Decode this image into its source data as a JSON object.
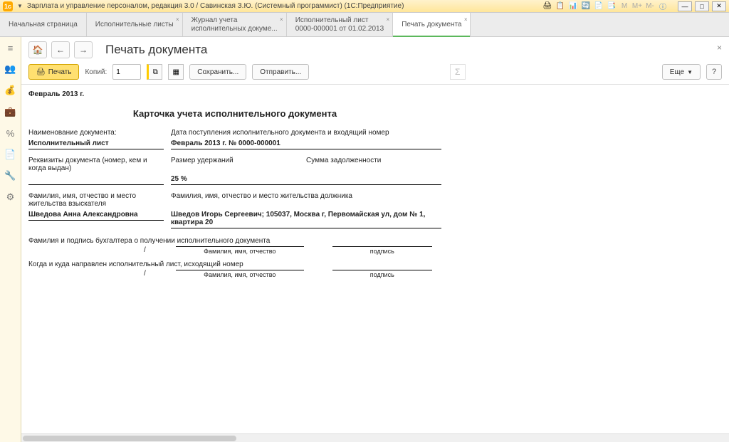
{
  "window": {
    "title": "Зарплата и управление персоналом, редакция 3.0 / Савинская З.Ю.  (Системный программист)  (1С:Предприятие)"
  },
  "tabs": [
    {
      "line1": "Начальная страница",
      "line2": ""
    },
    {
      "line1": "Исполнительные листы",
      "line2": ""
    },
    {
      "line1": "Журнал учета",
      "line2": "исполнительных докуме..."
    },
    {
      "line1": "Исполнительный лист",
      "line2": "0000-000001 от 01.02.2013"
    },
    {
      "line1": "Печать документа",
      "line2": ""
    }
  ],
  "page": {
    "title": "Печать документа"
  },
  "toolbar": {
    "print": "Печать",
    "copies_label": "Копий:",
    "copies_value": "1",
    "save": "Сохранить...",
    "send": "Отправить...",
    "more": "Еще"
  },
  "document": {
    "period": "Февраль 2013 г.",
    "heading": "Карточка учета исполнительного документа",
    "field1_label": "Наименование документа:",
    "field1_value": "Исполнительный лист",
    "field2_label": "Дата поступления исполнительного документа и входящий номер",
    "field2_value": "Февраль 2013 г. № 0000-000001",
    "field3_label": "Реквизиты документа (номер, кем и когда выдан)",
    "field4a_label": "Размер удержаний",
    "field4a_value": "25  %",
    "field4b_label": "Сумма задолженности",
    "field5_label": "Фамилия, имя, отчество и место жительства взыскателя",
    "field5_value": "Шведова Анна Александровна",
    "field6_label": "Фамилия, имя, отчество и место жительства должника",
    "field6_value": "Шведов Игорь Сергеевич; 105037, Москва г, Первомайская ул, дом № 1, квартира 20",
    "sig1_label": "Фамилия и подпись бухгалтера о получении исполнительного документа",
    "sig2_label": "Когда и куда направлен исполнительный лист, исходящий номер",
    "sig_fio": "Фамилия, имя, отчество",
    "sig_sign": "подпись"
  }
}
